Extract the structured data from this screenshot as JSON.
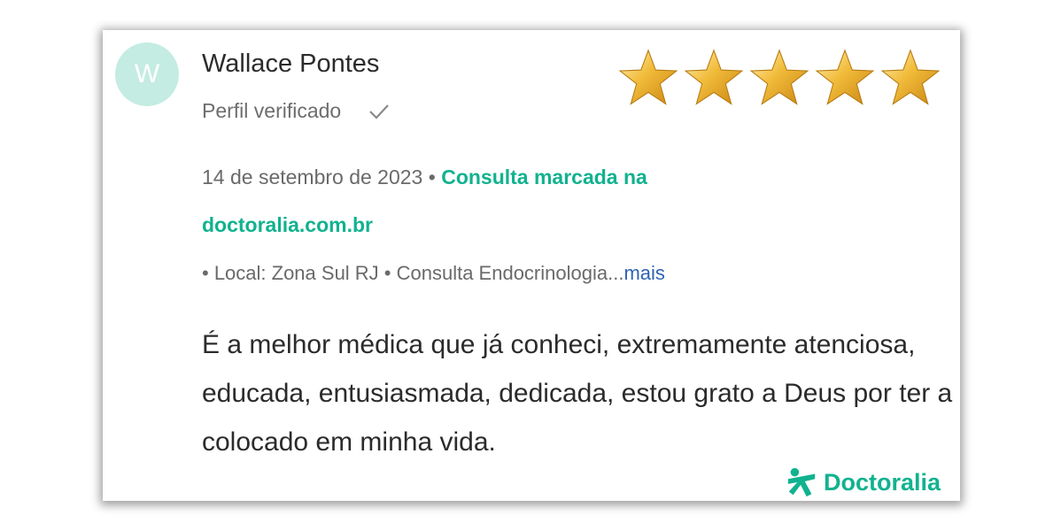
{
  "reviewer": {
    "avatar_letter": "W",
    "name": "Wallace Pontes",
    "verified_label": "Perfil verificado",
    "verified_icon": "check-icon"
  },
  "rating": {
    "stars": 5,
    "max": 5,
    "star_color": "#e5a21f"
  },
  "meta": {
    "date": "14 de setembro de 2023",
    "separator": " • ",
    "booking_prefix": "Consulta marcada na",
    "booking_site": "doctoralia.com.br",
    "details": "• Local: Zona Sul RJ • Consulta Endocrinologia...",
    "more_link": "mais"
  },
  "review": {
    "text": "É a melhor médica que já conheci, extremamente atenciosa, educada, entusiasmada, dedicada, estou grato a Deus por ter a colocado em minha vida."
  },
  "brand": {
    "name": "Doctoralia",
    "color": "#11b28f",
    "logo_icon": "doctoralia-logo-icon"
  }
}
